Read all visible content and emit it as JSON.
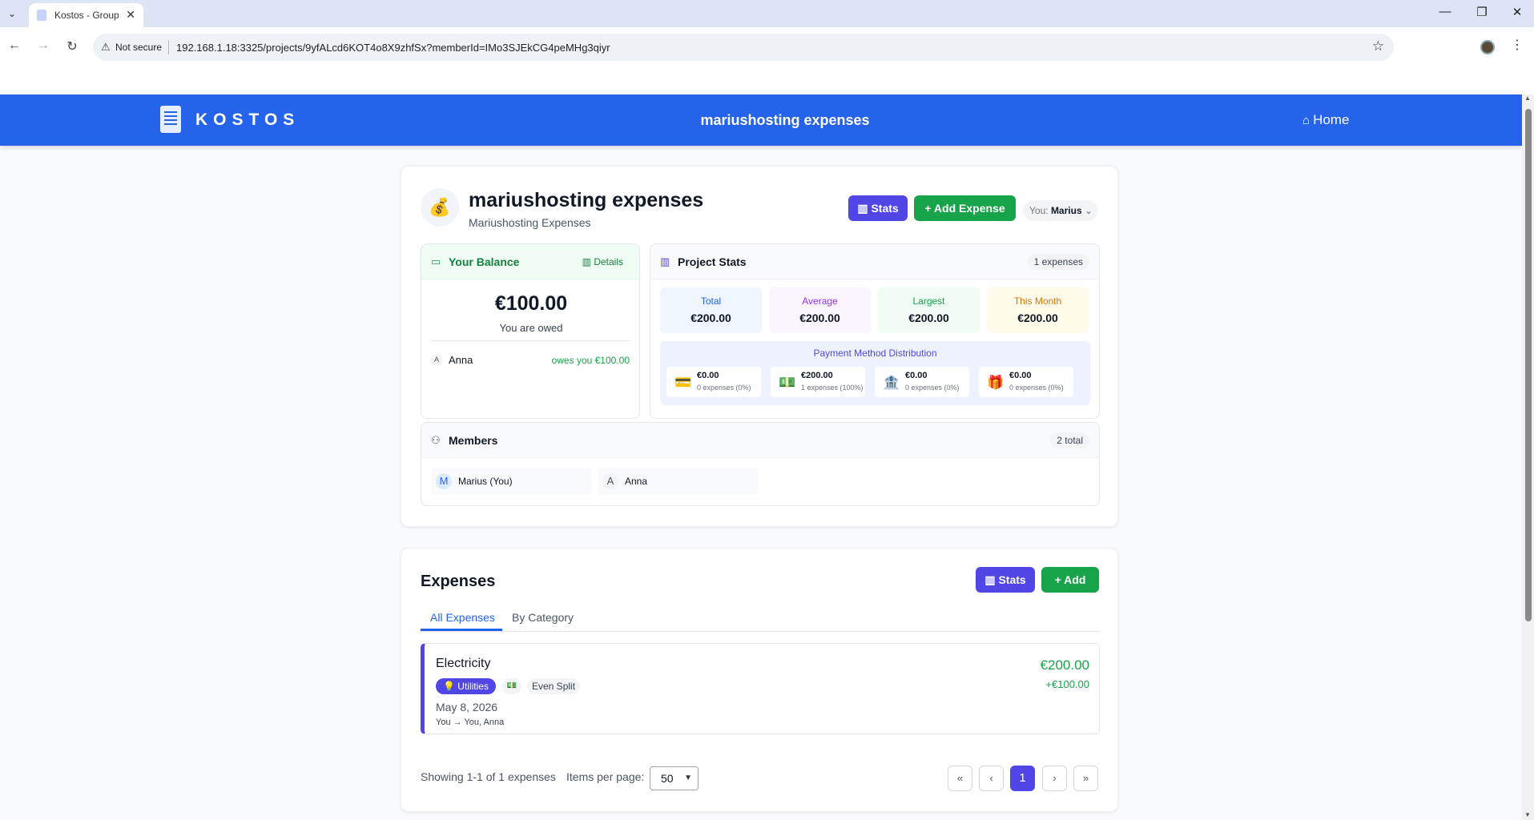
{
  "browser": {
    "tab_title": "Kostos - Group",
    "security_label": "Not secure",
    "url": "192.168.1.18:3325/projects/9yfALcd6KOT4o8X9zhfSx?memberId=IMo3SJEkCG4peMHg3qiyr"
  },
  "header": {
    "logo_text": "KOSTOS",
    "title": "mariushosting expenses",
    "home_label": "Home"
  },
  "project": {
    "avatar": "💰",
    "name": "mariushosting expenses",
    "description": "Mariushosting Expenses",
    "stats_button": "Stats",
    "add_expense_button": "Add Expense",
    "you_prefix": "You:",
    "you_name": "Marius"
  },
  "balance": {
    "title": "Your Balance",
    "details_label": "Details",
    "amount": "€100.00",
    "status": "You are owed",
    "debts": [
      {
        "initial": "A",
        "name": "Anna",
        "text": "owes you €100.00"
      }
    ]
  },
  "stats": {
    "title": "Project Stats",
    "count": "1 expenses",
    "tiles": [
      {
        "label": "Total",
        "value": "€200.00",
        "bg": "#eff6ff",
        "color": "#2563eb"
      },
      {
        "label": "Average",
        "value": "€200.00",
        "bg": "#faf5ff",
        "color": "#9333ea"
      },
      {
        "label": "Largest",
        "value": "€200.00",
        "bg": "#f0fdf4",
        "color": "#16a34a"
      },
      {
        "label": "This Month",
        "value": "€200.00",
        "bg": "#fffbeb",
        "color": "#d97706"
      }
    ],
    "payment_title": "Payment Method Distribution",
    "payment_methods": [
      {
        "icon": "💳",
        "value": "€0.00",
        "sub": "0 expenses (0%)"
      },
      {
        "icon": "💵",
        "value": "€200.00",
        "sub": "1 expenses (100%)"
      },
      {
        "icon": "🏦",
        "value": "€0.00",
        "sub": "0 expenses (0%)"
      },
      {
        "icon": "🎁",
        "value": "€0.00",
        "sub": "0 expenses (0%)"
      }
    ]
  },
  "members": {
    "title": "Members",
    "count": "2 total",
    "list": [
      {
        "initial": "M",
        "name": "Marius (You)"
      },
      {
        "initial": "A",
        "name": "Anna"
      }
    ]
  },
  "expenses": {
    "title": "Expenses",
    "stats_button": "Stats",
    "add_button": "Add",
    "tabs": [
      "All Expenses",
      "By Category"
    ],
    "items": [
      {
        "name": "Electricity",
        "category": "💡 Utilities",
        "payment_icon": "💵",
        "split": "Even Split",
        "date": "May 8, 2026",
        "flow": "You → You, Anna",
        "amount": "€200.00",
        "share": "+€100.00"
      }
    ],
    "showing": "Showing 1-1 of 1 expenses",
    "items_per_page_label": "Items per page:",
    "items_per_page_value": "50",
    "current_page": "1"
  },
  "colors": {
    "brand": "#2563eb",
    "accent": "#4f46e5",
    "success": "#16a34a"
  }
}
